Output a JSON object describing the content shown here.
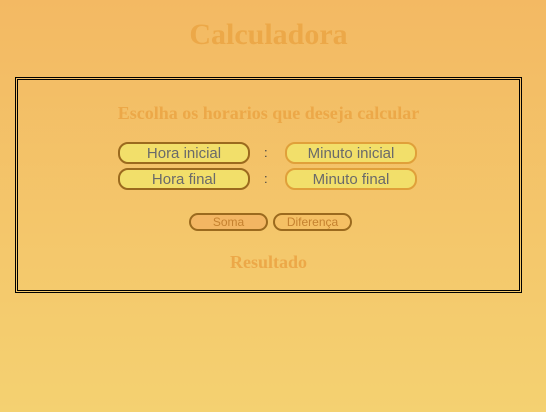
{
  "page": {
    "title": "Calculadora"
  },
  "panel": {
    "subtitle": "Escolha os horarios que deseja calcular",
    "separator": ":",
    "start": {
      "hour_placeholder": "Hora inicial",
      "minute_placeholder": "Minuto inicial"
    },
    "end": {
      "hour_placeholder": "Hora final",
      "minute_placeholder": "Minuto final"
    },
    "buttons": {
      "sum_label": "Soma",
      "difference_label": "Diferença"
    },
    "result_label": "Resultado"
  },
  "colors": {
    "background_top": "#f3b963",
    "background_bottom": "#f4d171",
    "heading_text": "#eca848",
    "input_fill": "#f2df6a",
    "input_border": "#9b6a1e",
    "button_fill": "#f3b663"
  }
}
